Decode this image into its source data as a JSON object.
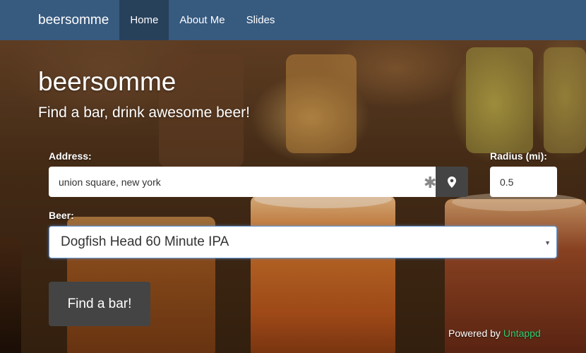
{
  "navbar": {
    "brand": "beersomme",
    "items": [
      {
        "label": "Home",
        "active": true
      },
      {
        "label": "About Me",
        "active": false
      },
      {
        "label": "Slides",
        "active": false
      }
    ]
  },
  "hero": {
    "title": "beersomme",
    "subtitle": "Find a bar, drink awesome beer!"
  },
  "form": {
    "address_label": "Address:",
    "address_value": "union square, new york",
    "radius_label": "Radius (mi):",
    "radius_value": "0.5",
    "beer_label": "Beer:",
    "beer_value": "Dogfish Head 60 Minute IPA",
    "submit_label": "Find a bar!"
  },
  "footer": {
    "powered_by": "Powered by",
    "provider": "Untappd"
  },
  "icons": {
    "locate": "map-marker-icon",
    "required": "asterisk-icon",
    "dropdown": "caret-down-icon"
  },
  "colors": {
    "navbar": "#375a7f",
    "navbar_active": "#28415b",
    "button": "#444444",
    "provider_link": "#2ecc71"
  }
}
